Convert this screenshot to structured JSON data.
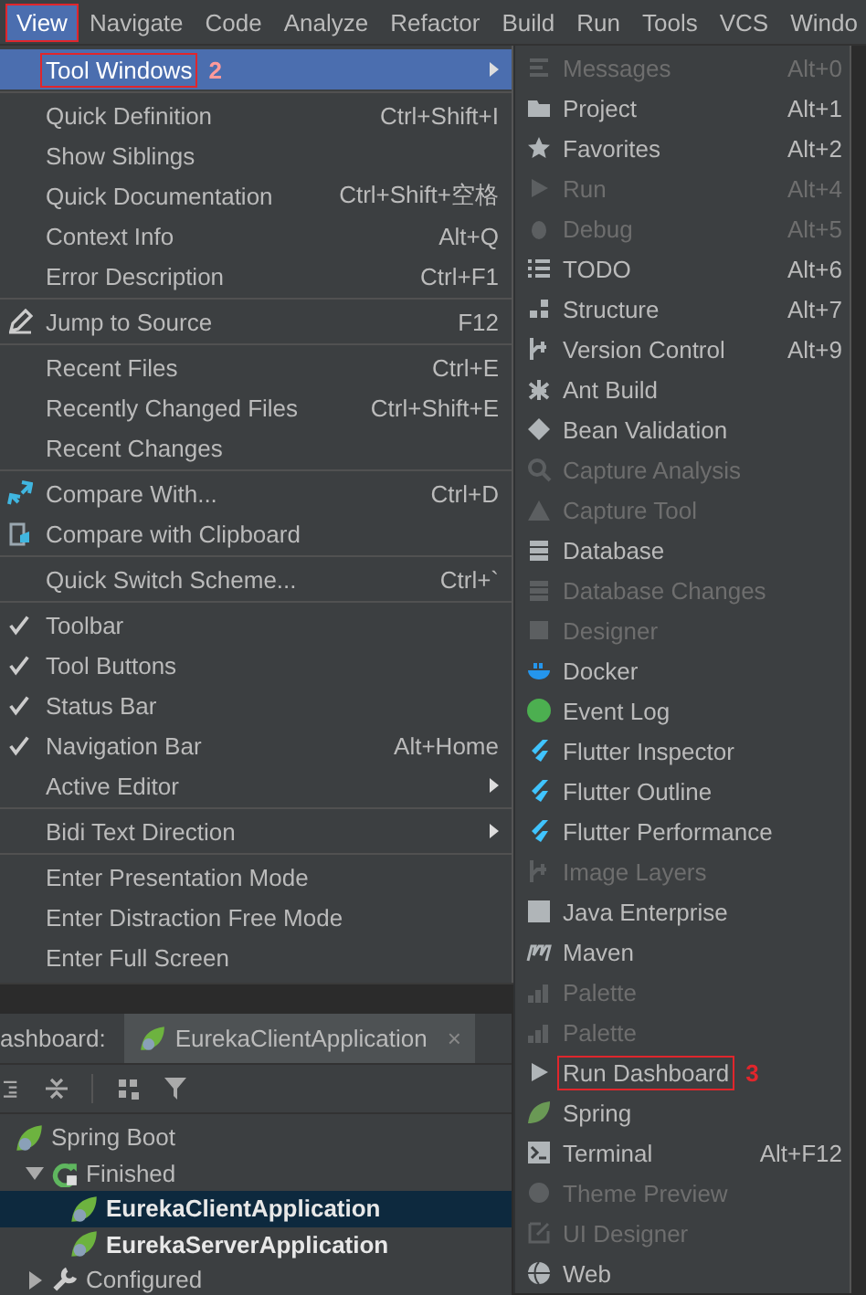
{
  "menubar": [
    {
      "label": "View",
      "selected": true,
      "marked": true
    },
    {
      "label": "Navigate",
      "selected": false,
      "marked": false
    },
    {
      "label": "Code",
      "selected": false,
      "marked": false
    },
    {
      "label": "Analyze",
      "selected": false,
      "marked": false
    },
    {
      "label": "Refactor",
      "selected": false,
      "marked": false
    },
    {
      "label": "Build",
      "selected": false,
      "marked": false
    },
    {
      "label": "Run",
      "selected": false,
      "marked": false
    },
    {
      "label": "Tools",
      "selected": false,
      "marked": false
    },
    {
      "label": "VCS",
      "selected": false,
      "marked": false
    },
    {
      "label": "Windo",
      "selected": false,
      "marked": false
    }
  ],
  "view_menu": [
    {
      "kind": "submenu",
      "label": "Tool Windows",
      "selected": true,
      "checked": false,
      "marked": true,
      "callout": "2"
    },
    {
      "kind": "separator"
    },
    {
      "kind": "item",
      "label": "Quick Definition",
      "shortcut": "Ctrl+Shift+I",
      "selected": false,
      "checked": false,
      "marked": false
    },
    {
      "kind": "item",
      "label": "Show Siblings",
      "selected": false,
      "checked": false,
      "marked": false
    },
    {
      "kind": "item",
      "label": "Quick Documentation",
      "shortcut": "Ctrl+Shift+空格",
      "selected": false,
      "checked": false,
      "marked": false
    },
    {
      "kind": "item",
      "label": "Context Info",
      "shortcut": "Alt+Q",
      "selected": false,
      "checked": false,
      "marked": false
    },
    {
      "kind": "item",
      "label": "Error Description",
      "shortcut": "Ctrl+F1",
      "selected": false,
      "checked": false,
      "marked": false
    },
    {
      "kind": "separator"
    },
    {
      "kind": "item",
      "label": "Jump to Source",
      "shortcut": "F12",
      "selected": false,
      "checked": false,
      "marked": false
    },
    {
      "kind": "separator"
    },
    {
      "kind": "item",
      "label": "Recent Files",
      "shortcut": "Ctrl+E",
      "selected": false,
      "checked": false,
      "marked": false
    },
    {
      "kind": "item",
      "label": "Recently Changed Files",
      "shortcut": "Ctrl+Shift+E",
      "selected": false,
      "checked": false,
      "marked": false
    },
    {
      "kind": "item",
      "label": "Recent Changes",
      "selected": false,
      "checked": false,
      "marked": false
    },
    {
      "kind": "separator"
    },
    {
      "kind": "item",
      "label": "Compare With...",
      "shortcut": "Ctrl+D",
      "selected": false,
      "checked": false,
      "marked": false
    },
    {
      "kind": "item",
      "label": "Compare with Clipboard",
      "selected": false,
      "checked": false,
      "marked": false
    },
    {
      "kind": "separator"
    },
    {
      "kind": "item",
      "label": "Quick Switch Scheme...",
      "shortcut": "Ctrl+`",
      "selected": false,
      "checked": false,
      "marked": false
    },
    {
      "kind": "separator"
    },
    {
      "kind": "item",
      "label": "Toolbar",
      "selected": false,
      "checked": true,
      "marked": false
    },
    {
      "kind": "item",
      "label": "Tool Buttons",
      "selected": false,
      "checked": true,
      "marked": false
    },
    {
      "kind": "item",
      "label": "Status Bar",
      "selected": false,
      "checked": true,
      "marked": false
    },
    {
      "kind": "item",
      "label": "Navigation Bar",
      "shortcut": "Alt+Home",
      "selected": false,
      "checked": true,
      "marked": false
    },
    {
      "kind": "submenu",
      "label": "Active Editor",
      "selected": false,
      "checked": false,
      "marked": false
    },
    {
      "kind": "separator"
    },
    {
      "kind": "submenu",
      "label": "Bidi Text Direction",
      "selected": false,
      "checked": false,
      "marked": false
    },
    {
      "kind": "separator"
    },
    {
      "kind": "item",
      "label": "Enter Presentation Mode",
      "selected": false,
      "checked": false,
      "marked": false
    },
    {
      "kind": "item",
      "label": "Enter Distraction Free Mode",
      "selected": false,
      "checked": false,
      "marked": false
    },
    {
      "kind": "item",
      "label": "Enter Full Screen",
      "selected": false,
      "checked": false,
      "marked": false
    }
  ],
  "tool_windows": [
    {
      "label": "Messages",
      "shortcut": "Alt+0",
      "disabled": true,
      "marked": false
    },
    {
      "label": "Project",
      "shortcut": "Alt+1",
      "disabled": false,
      "marked": false
    },
    {
      "label": "Favorites",
      "shortcut": "Alt+2",
      "disabled": false,
      "marked": false
    },
    {
      "label": "Run",
      "shortcut": "Alt+4",
      "disabled": true,
      "marked": false
    },
    {
      "label": "Debug",
      "shortcut": "Alt+5",
      "disabled": true,
      "marked": false
    },
    {
      "label": "TODO",
      "shortcut": "Alt+6",
      "disabled": false,
      "marked": false
    },
    {
      "label": "Structure",
      "shortcut": "Alt+7",
      "disabled": false,
      "marked": false
    },
    {
      "label": "Version Control",
      "shortcut": "Alt+9",
      "disabled": false,
      "marked": false
    },
    {
      "label": "Ant Build",
      "disabled": false,
      "marked": false
    },
    {
      "label": "Bean Validation",
      "disabled": false,
      "marked": false
    },
    {
      "label": "Capture Analysis",
      "disabled": true,
      "marked": false
    },
    {
      "label": "Capture Tool",
      "disabled": true,
      "marked": false
    },
    {
      "label": "Database",
      "disabled": false,
      "marked": false
    },
    {
      "label": "Database Changes",
      "disabled": true,
      "marked": false
    },
    {
      "label": "Designer",
      "disabled": true,
      "marked": false
    },
    {
      "label": "Docker",
      "disabled": false,
      "marked": false
    },
    {
      "label": "Event Log",
      "disabled": false,
      "marked": false
    },
    {
      "label": "Flutter Inspector",
      "disabled": false,
      "marked": false
    },
    {
      "label": "Flutter Outline",
      "disabled": false,
      "marked": false
    },
    {
      "label": "Flutter Performance",
      "disabled": false,
      "marked": false
    },
    {
      "label": "Image Layers",
      "disabled": true,
      "marked": false
    },
    {
      "label": "Java Enterprise",
      "disabled": false,
      "marked": false
    },
    {
      "label": "Maven",
      "disabled": false,
      "marked": false
    },
    {
      "label": "Palette",
      "disabled": true,
      "marked": false
    },
    {
      "label": "Palette",
      "disabled": true,
      "marked": false
    },
    {
      "label": "Run Dashboard",
      "disabled": false,
      "marked": true,
      "callout": "3"
    },
    {
      "label": "Spring",
      "disabled": false,
      "marked": false
    },
    {
      "label": "Terminal",
      "shortcut": "Alt+F12",
      "disabled": false,
      "marked": false
    },
    {
      "label": "Theme Preview",
      "disabled": true,
      "marked": false
    },
    {
      "label": "UI Designer",
      "disabled": true,
      "marked": false
    },
    {
      "label": "Web",
      "disabled": false,
      "marked": false
    }
  ],
  "run_dashboard": {
    "title": "ashboard:",
    "tab": {
      "label": "EurekaClientApplication",
      "close": "×"
    },
    "tree": [
      {
        "label": "Spring Boot",
        "active": false,
        "selected": false,
        "children": [
          {
            "label": "Finished",
            "active": false,
            "selected": false,
            "expanded": true,
            "children": [
              {
                "label": "EurekaClientApplication",
                "active": true,
                "selected": true
              },
              {
                "label": "EurekaServerApplication",
                "active": true,
                "selected": false
              }
            ]
          },
          {
            "label": "Configured",
            "active": false,
            "selected": false,
            "expanded": false
          }
        ]
      }
    ]
  }
}
